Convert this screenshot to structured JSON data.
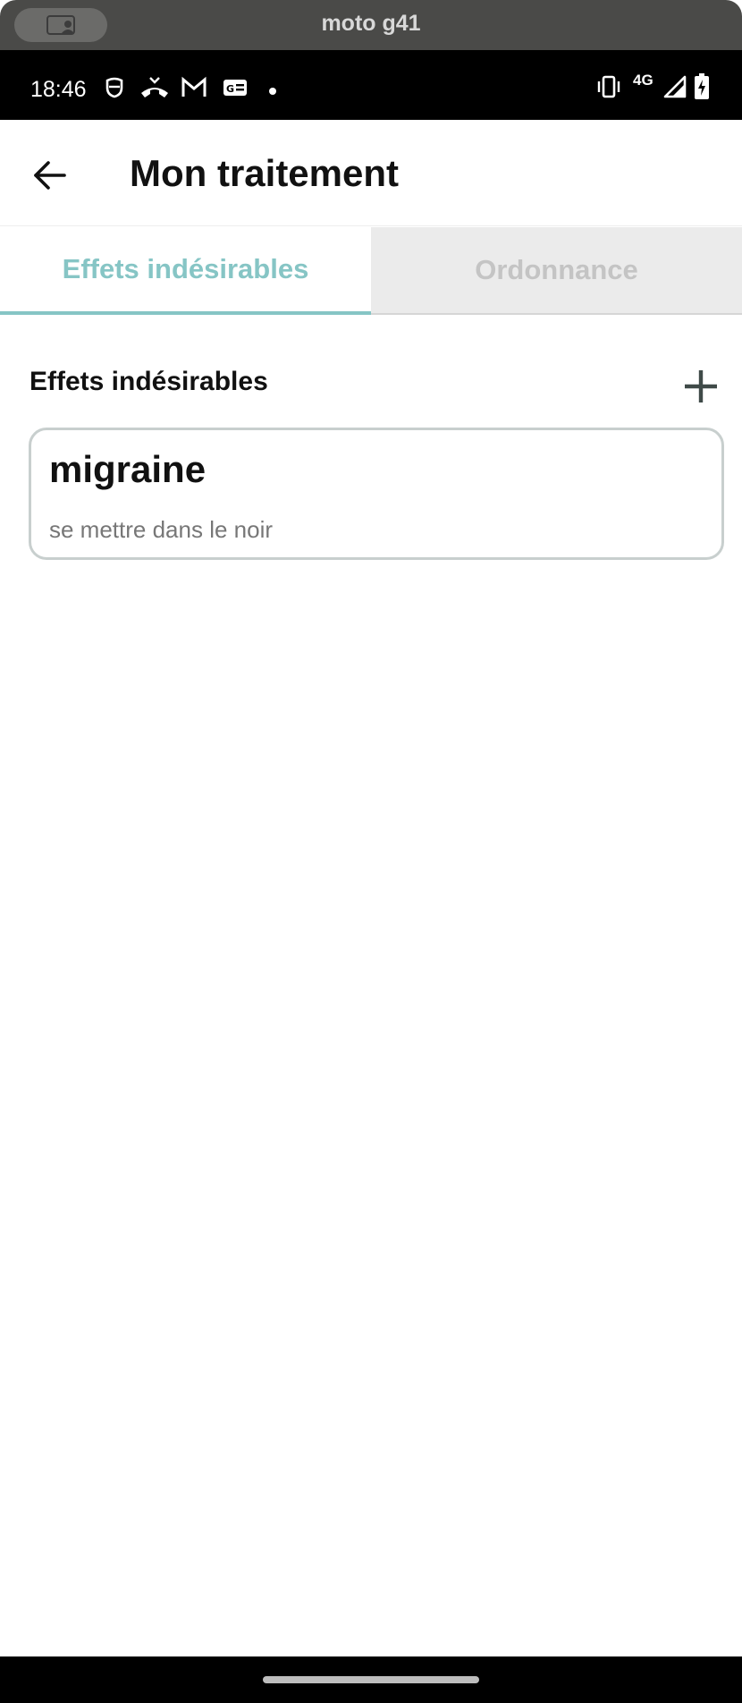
{
  "device": {
    "name": "moto g41"
  },
  "statusbar": {
    "time": "18:46",
    "network": "4G",
    "left_icons": [
      "mask-icon",
      "missed-call-icon",
      "gmail-icon",
      "news-icon",
      "dot-icon"
    ],
    "right_icons": [
      "vibrate-icon",
      "network-4g-icon",
      "signal-icon",
      "battery-charging-icon"
    ]
  },
  "appbar": {
    "title": "Mon traitement",
    "back_icon": "arrow-left-icon"
  },
  "tabs": [
    {
      "label": "Effets indésirables",
      "active": true
    },
    {
      "label": "Ordonnance",
      "active": false
    }
  ],
  "section": {
    "title": "Effets indésirables",
    "add_icon": "plus-icon"
  },
  "effects": [
    {
      "title": "migraine",
      "description": "se mettre dans le noir"
    }
  ],
  "colors": {
    "accent": "#86c5c5",
    "inactive_tab_bg": "#ebebeb",
    "inactive_tab_text": "#c4c4c4",
    "card_border": "#c8cfce"
  }
}
